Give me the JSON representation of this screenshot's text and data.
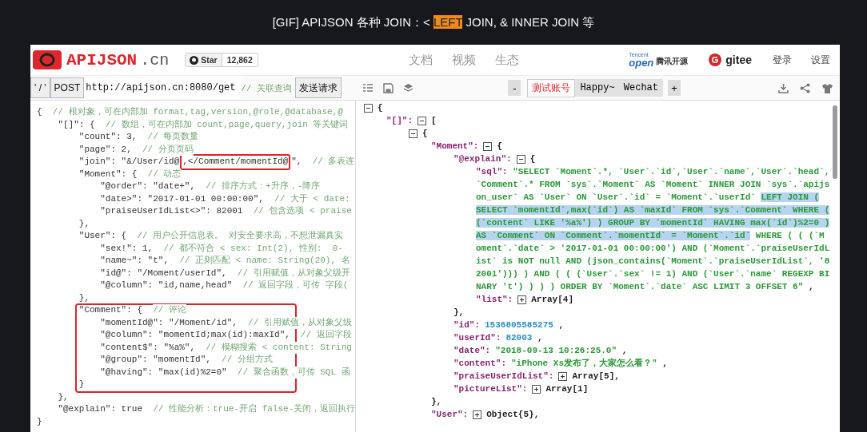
{
  "caption": [
    {
      "text": "[GIF] APIJSON 各种 JOIN：< ",
      "highlighted": false
    },
    {
      "text": "LEFT",
      "highlighted": true
    },
    {
      "text": " JOIN, & INNER JOIN 等",
      "highlighted": false
    }
  ],
  "header": {
    "logo_text": "APIJSON",
    "logo_suffix": ".cn",
    "star": {
      "label": "Star",
      "count": "12,862"
    },
    "nav": [
      "文档",
      "视频",
      "生态"
    ],
    "partner": {
      "top": "Tencent",
      "brand": "open",
      "name": "腾讯开源"
    },
    "gitee": "gitee",
    "actions": [
      "登录",
      "设置"
    ]
  },
  "toolbar": {
    "quote_button": "' / '",
    "method_button": "POST",
    "url": "http://apijson.cn:8080/get",
    "url_comment": "// 关联查询",
    "send_button": "发送请求",
    "minus_button": "-",
    "account_label": "测试账号",
    "account_name": "Happy~ Wechat",
    "plus_button": "+"
  },
  "request_lines": [
    {
      "code": "{",
      "comment": "// 根对象，可在内部加 format,tag,version,@role,@database,@",
      "boxed": false
    },
    {
      "code": "    \"[]\": {",
      "comment": "// 数组，可在内部加 count,page,query,join 等关键词",
      "boxed": false
    },
    {
      "code": "        \"count\": 3,",
      "comment": "// 每页数量",
      "boxed": false
    },
    {
      "code": "        \"page\": 2,",
      "comment": "// 分页页码",
      "boxed": false
    },
    {
      "code": "        \"join\": \"&/User/id@",
      "marked": ",</Comment/momentId@",
      "code_after": "\",",
      "comment": "// 多表连",
      "boxed": false
    },
    {
      "code": "        \"Moment\": {",
      "comment": "// 动态",
      "boxed": false
    },
    {
      "code": "            \"@order\": \"date+\",",
      "comment": "// 排序方式：+升序，-降序",
      "boxed": false
    },
    {
      "code": "            \"date>\": \"2017-01-01 00:00:00\",",
      "comment": "// 大于 < date:",
      "boxed": false
    },
    {
      "code": "            \"praiseUserIdList<>\": 82001",
      "comment": "// 包含选项 < praise",
      "boxed": false
    },
    {
      "code": "        },",
      "boxed": false
    },
    {
      "code": "        \"User\": {",
      "comment": "// 用户公开信息表。 对安全要求高，不想泄漏真实",
      "boxed": false
    },
    {
      "code": "            \"sex!\": 1,",
      "comment": "// 都不符合 < sex: Int(2), 性别:  0-",
      "boxed": false
    },
    {
      "code": "            \"name~\": \"t\",",
      "comment": "// 正则匹配 < name: String(20), 名",
      "boxed": false
    },
    {
      "code": "            \"id@\": \"/Moment/userId\",",
      "comment": "// 引用赋值，从对象父级开",
      "boxed": false
    },
    {
      "code": "            \"@column\": \"id,name,head\"",
      "comment": "// 返回字段，可传 字段(",
      "boxed": false
    },
    {
      "code": "        },",
      "boxed": false
    },
    {
      "code": "        \"Comment\": {",
      "comment": "// 评论",
      "boxed": true
    },
    {
      "code": "            \"momentId@\": \"/Moment/id\",",
      "comment": "// 引用赋值，从对象父级",
      "boxed": true
    },
    {
      "code": "            \"@column\": \"momentId;max(id):maxId\",",
      "comment": "// 返回字段",
      "boxed": true
    },
    {
      "code": "            \"content$\": \"%a%\",",
      "comment": "// 模糊搜索 < content: String",
      "boxed": true
    },
    {
      "code": "            \"@group\": \"momentId\",",
      "comment": "// 分组方式",
      "boxed": true
    },
    {
      "code": "            \"@having\": \"max(id)%2=0\"",
      "comment": "// 聚合函数，可传 SQL 函",
      "boxed": true
    },
    {
      "code": "        }",
      "boxed": true
    },
    {
      "code": "    },",
      "boxed": false
    },
    {
      "code": "    \"@explain\": true",
      "comment": "// 性能分析：true-开启 false-关闭，返回执行",
      "boxed": false
    },
    {
      "code": "}",
      "boxed": false
    }
  ],
  "response_tree": {
    "kind": "branch",
    "expanded": true,
    "value": "{",
    "children": [
      {
        "kind": "branch",
        "key": "\"[]\":",
        "expanded": true,
        "value": "[",
        "children": [
          {
            "kind": "branch",
            "expanded": true,
            "value": "{",
            "children": [
              {
                "kind": "branch",
                "key": "\"Moment\":",
                "expanded": true,
                "value": "{",
                "close": "},",
                "children": [
                  {
                    "kind": "branch",
                    "key": "\"@explain\":",
                    "expanded": true,
                    "value": "{",
                    "close": "},",
                    "children": [
                      {
                        "kind": "sql",
                        "key": "\"sql\":",
                        "before": "\"SELECT `Moment`.*, `User`.`id`,`User`.`name`,`User`.`head`, `Comment`.* FROM `sys`.`Moment` AS `Moment` INNER JOIN `sys`.`apijson_user` AS `User` ON `User`.`id` = `Moment`.`userId` ",
                        "highlighted": "LEFT JOIN ( SELECT `momentId`,max(`id`) AS `maxId` FROM `sys`.`Comment` WHERE ( (`content` LIKE '%a%') ) GROUP BY `momentId` HAVING max(`id`)%2=0 ) AS `Comment` ON `Comment`.`momentId` = `Moment`.`id`",
                        "after": " WHERE ( ( (`Moment`.`date` > '2017-01-01 00:00:00') AND (`Moment`.`praiseUserIdList` is NOT null AND (json_contains(`Moment`.`praiseUserIdList`, '82001'))) ) AND ( ( (`User`.`sex` != 1) AND (`User`.`name` REGEXP BINARY 't') ) ) ) ORDER BY `Moment`.`date` ASC LIMIT 3 OFFSET 6\"",
                        "suffix": " ,"
                      },
                      {
                        "kind": "branch",
                        "key": "\"list\":",
                        "expanded": false,
                        "value": "Array[4]"
                      }
                    ]
                  },
                  {
                    "kind": "number",
                    "key": "\"id\":",
                    "value": "1536805585275",
                    "suffix": " ,"
                  },
                  {
                    "kind": "number",
                    "key": "\"userId\":",
                    "value": "82003",
                    "suffix": " ,"
                  },
                  {
                    "kind": "string",
                    "key": "\"date\":",
                    "value": "\"2018-09-13 10:26:25.0\"",
                    "suffix": " ,"
                  },
                  {
                    "kind": "string",
                    "key": "\"content\":",
                    "value": "\"iPhone Xs发布了，大家怎么看？\"",
                    "suffix": " ,"
                  },
                  {
                    "kind": "branch",
                    "key": "\"praiseUserIdList\":",
                    "expanded": false,
                    "value": "Array[5],"
                  },
                  {
                    "kind": "branch",
                    "key": "\"pictureList\":",
                    "expanded": false,
                    "value": "Array[1]"
                  }
                ]
              },
              {
                "kind": "branch",
                "key": "\"User\":",
                "expanded": false,
                "value": "Object{5},"
              }
            ]
          }
        ]
      }
    ]
  }
}
